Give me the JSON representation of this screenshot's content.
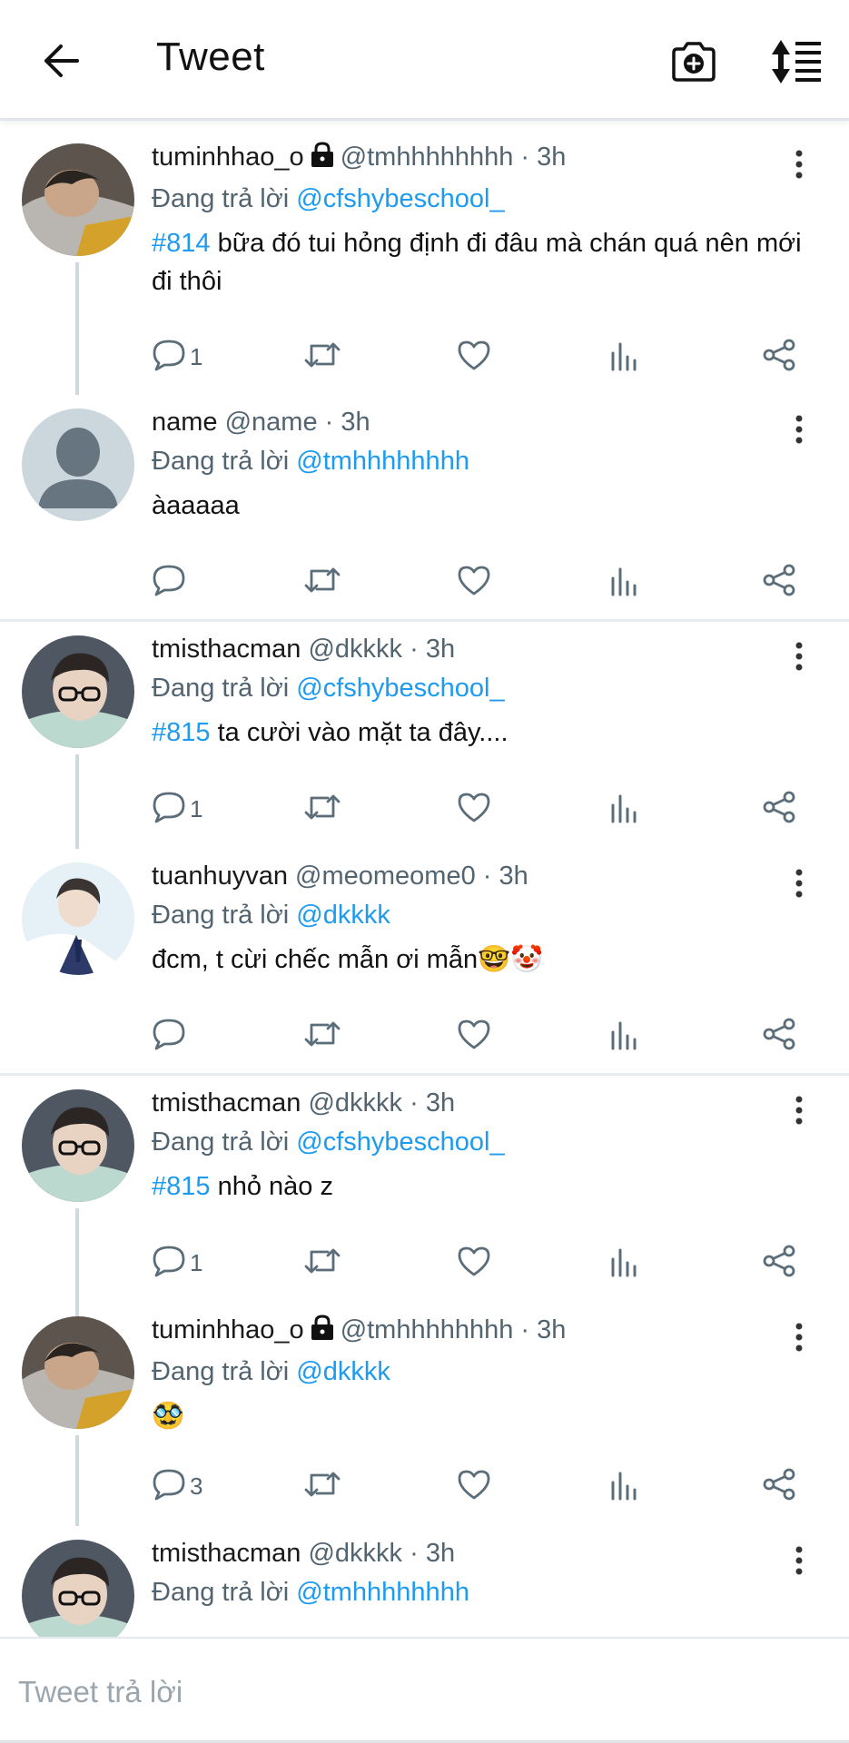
{
  "topbar": {
    "title": "Tweet",
    "back_icon": "back-arrow-icon",
    "camera_icon": "camera-plus-icon",
    "sort_icon": "sort-list-icon"
  },
  "tweets": [
    {
      "display_name": "tuminhhao_o",
      "locked": true,
      "handle": "@tmhhhhhhhh",
      "time": "3h",
      "reply_prefix": "Đang trả lời",
      "reply_to": "@cfshybeschool_",
      "tag": "#814",
      "text": " bữa đó tui hỏng định đi đâu mà chán quá nên mới đi thôi",
      "reply_count": "1"
    },
    {
      "display_name": "name",
      "locked": false,
      "handle": "@name",
      "time": "3h",
      "reply_prefix": "Đang trả lời",
      "reply_to": "@tmhhhhhhhh",
      "tag": "",
      "text": "àaaaaa",
      "reply_count": ""
    },
    {
      "display_name": "tmisthacman",
      "locked": false,
      "handle": "@dkkkk",
      "time": "3h",
      "reply_prefix": "Đang trả lời",
      "reply_to": "@cfshybeschool_",
      "tag": "#815",
      "text": " ta cười vào mặt ta đây....",
      "reply_count": "1"
    },
    {
      "display_name": "tuanhuyvan",
      "locked": false,
      "handle": "@meomeome0",
      "time": "3h",
      "reply_prefix": "Đang trả lời",
      "reply_to": "@dkkkk",
      "tag": "",
      "text": "đcm, t cừi chếc mẫn ơi mẫn🤓🤡",
      "reply_count": ""
    },
    {
      "display_name": "tmisthacman",
      "locked": false,
      "handle": "@dkkkk",
      "time": "3h",
      "reply_prefix": "Đang trả lời",
      "reply_to": "@cfshybeschool_",
      "tag": "#815",
      "text": " nhỏ nào z",
      "reply_count": "1"
    },
    {
      "display_name": "tuminhhao_o",
      "locked": true,
      "handle": "@tmhhhhhhhh",
      "time": "3h",
      "reply_prefix": "Đang trả lời",
      "reply_to": "@dkkkk",
      "tag": "",
      "text": "🥸",
      "reply_count": "3"
    },
    {
      "display_name": "tmisthacman",
      "locked": false,
      "handle": "@dkkkk",
      "time": "3h",
      "reply_prefix": "Đang trả lời",
      "reply_to": "@tmhhhhhhhh",
      "tag": "",
      "text": "",
      "reply_count": ""
    }
  ],
  "compose": {
    "placeholder": "Tweet trả lời"
  },
  "colors": {
    "link": "#1d9bf0",
    "secondary": "#536471",
    "divider": "#e8ecee",
    "thread_line": "#cfd9de"
  }
}
